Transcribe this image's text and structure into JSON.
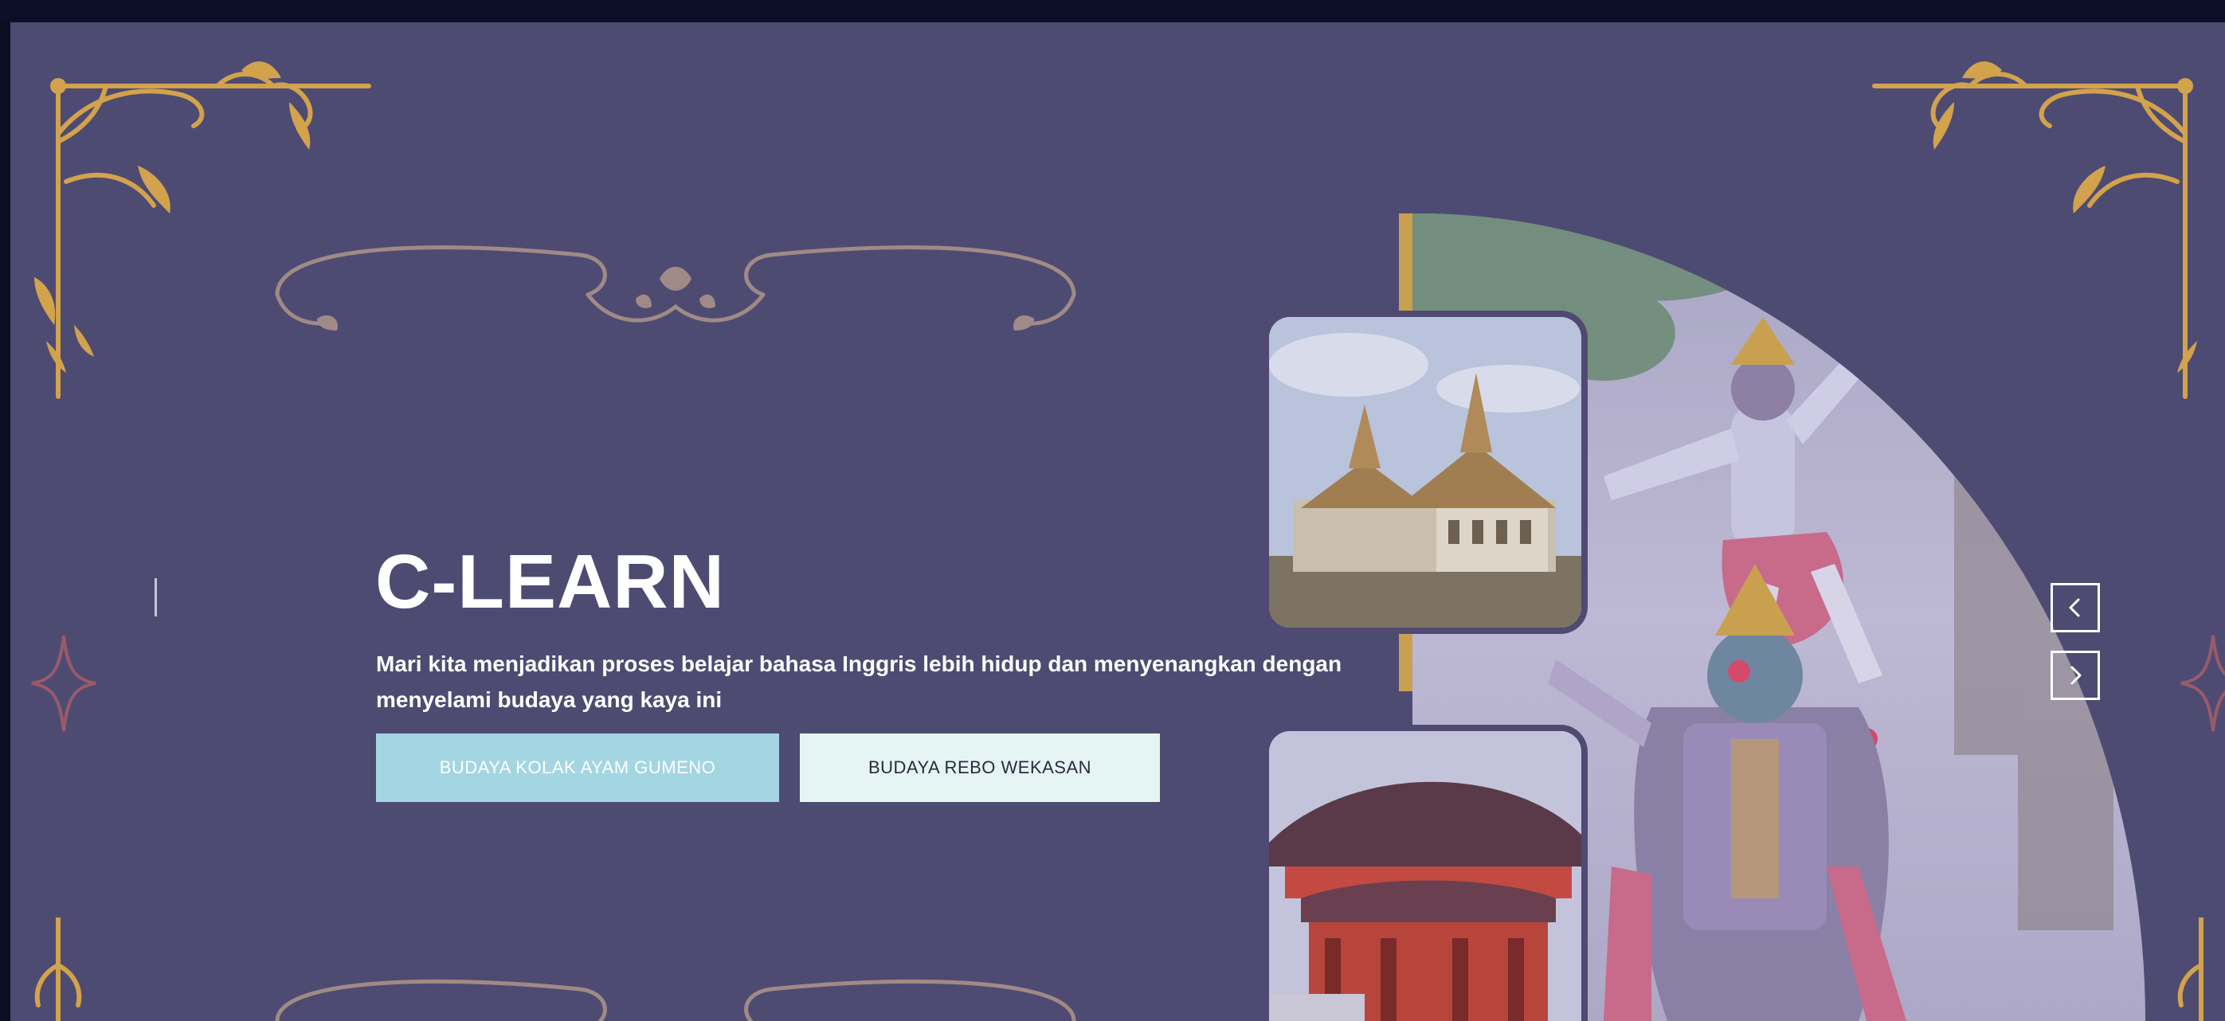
{
  "hero": {
    "title": "C-LEARN",
    "description": "Mari kita menjadikan proses belajar bahasa Inggris lebih hidup dan menyenangkan dengan menyelami budaya yang kaya ini",
    "buttons": {
      "primary_label": "BUDAYA KOLAK AYAM GUMENO",
      "secondary_label": "BUDAYA REBO WEKASAN"
    }
  },
  "carousel": {
    "prev_icon": "chevron-left-icon",
    "next_icon": "chevron-right-icon"
  },
  "images": {
    "main": "khon-dancers-image",
    "top": "thai-palace-image",
    "bottom": "japanese-shrine-image"
  },
  "colors": {
    "background": "#4e4b72",
    "accent_gold": "#c8a050",
    "primary_button": "#a3d6e2",
    "secondary_button": "#e4f5f4",
    "text": "#ffffff"
  }
}
